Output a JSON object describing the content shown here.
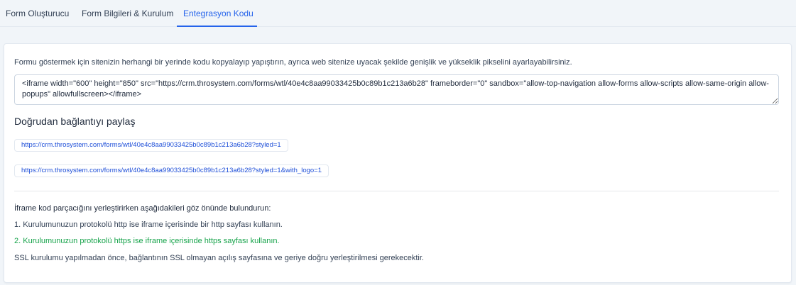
{
  "tabs": [
    {
      "label": "Form Oluşturucu",
      "active": false
    },
    {
      "label": "Form Bilgileri & Kurulum",
      "active": false
    },
    {
      "label": "Entegrasyon Kodu",
      "active": true
    }
  ],
  "integration": {
    "intro": "Formu göstermek için sitenizin herhangi bir yerinde kodu kopyalayıp yapıştırın, ayrıca web sitenize uyacak şekilde genişlik ve yükseklik pikselini ayarlayabilirsiniz.",
    "embed_code": "<iframe width=\"600\" height=\"850\" src=\"https://crm.throsystem.com/forms/wtl/40e4c8aa99033425b0c89b1c213a6b28\" frameborder=\"0\" sandbox=\"allow-top-navigation allow-forms allow-scripts allow-same-origin allow-popups\" allowfullscreen></iframe>",
    "direct_link_heading": "Doğrudan bağlantıyı paylaş",
    "links": [
      "https://crm.throsystem.com/forms/wtl/40e4c8aa99033425b0c89b1c213a6b28?styled=1",
      "https://crm.throsystem.com/forms/wtl/40e4c8aa99033425b0c89b1c213a6b28?styled=1&with_logo=1"
    ],
    "notes": {
      "title": "İframe kod parçacığını yerleştirirken aşağıdakileri göz önünde bulundurun:",
      "item1": "1. Kurulumunuzun protokolü http ise iframe içerisinde bir http sayfası kullanın.",
      "item2": "2. Kurulumunuzun protokolü https ise iframe içerisinde https sayfası kullanın.",
      "ssl": "SSL kurulumu yapılmadan önce, bağlantının SSL olmayan açılış sayfasına ve geriye doğru yerleştirilmesi gerekecektir."
    }
  },
  "colors": {
    "accent": "#2563eb",
    "link": "#1d4ed8",
    "success": "#16a34a"
  }
}
